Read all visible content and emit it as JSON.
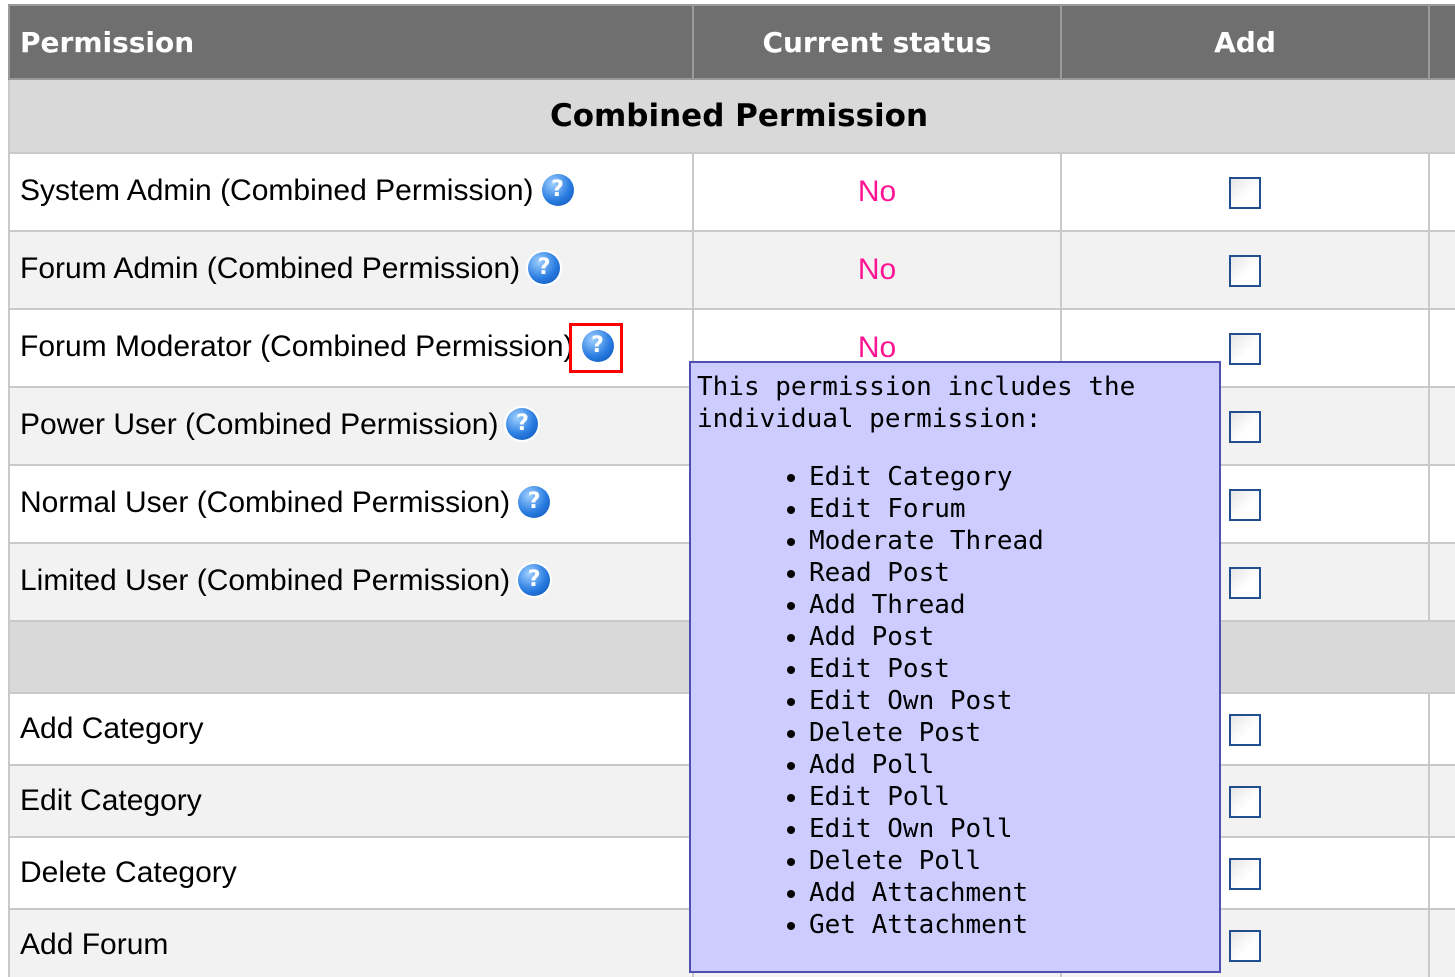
{
  "table": {
    "headers": [
      "Permission",
      "Current status",
      "Add"
    ],
    "combined_section_title": "Combined Permission",
    "combined_rows": [
      {
        "label": "System Admin (Combined Permission)",
        "status": "No",
        "help_icon": "help-icon"
      },
      {
        "label": "Forum Admin (Combined Permission)",
        "status": "No",
        "help_icon": "help-icon"
      },
      {
        "label": "Forum Moderator (Combined Permission)",
        "status": "No",
        "help_icon": "help-icon"
      },
      {
        "label": "Power User (Combined Permission)",
        "status": "",
        "help_icon": "help-icon"
      },
      {
        "label": "Normal User (Combined Permission)",
        "status": "",
        "help_icon": "help-icon"
      },
      {
        "label": "Limited User (Combined Permission)",
        "status": "",
        "help_icon": "help-icon"
      }
    ],
    "individual_rows": [
      {
        "label": "Add Category"
      },
      {
        "label": "Edit Category"
      },
      {
        "label": "Delete Category"
      },
      {
        "label": "Add Forum"
      }
    ]
  },
  "tooltip": {
    "intro": "This permission includes the individual permission:",
    "items": [
      "Edit Category",
      "Edit Forum",
      "Moderate Thread",
      "Read Post",
      "Add Thread",
      "Add Post",
      "Edit Post",
      "Edit Own Post",
      "Delete Post",
      "Add Poll",
      "Edit Poll",
      "Edit Own Poll",
      "Delete Poll",
      "Add Attachment",
      "Get Attachment"
    ]
  },
  "colors": {
    "header_bg": "#6f6f6f",
    "section_bg": "#d9d9d9",
    "status_no": "#ff1493",
    "tooltip_bg": "#ccccff",
    "highlight": "#ff0000"
  }
}
